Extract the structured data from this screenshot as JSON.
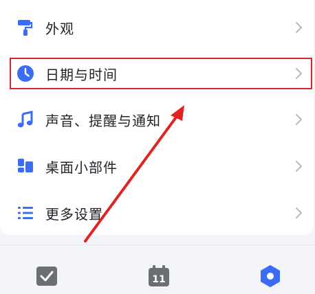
{
  "menu": {
    "items": [
      {
        "label": "外观",
        "icon": "paint-roller-icon"
      },
      {
        "label": "日期与时间",
        "icon": "clock-icon"
      },
      {
        "label": "声音、提醒与通知",
        "icon": "music-note-icon"
      },
      {
        "label": "桌面小部件",
        "icon": "widgets-icon"
      },
      {
        "label": "更多设置",
        "icon": "list-icon"
      }
    ]
  },
  "tabbar": {
    "tabs": [
      {
        "name": "tasks",
        "icon": "checkbox-icon"
      },
      {
        "name": "calendar",
        "icon": "calendar-icon",
        "text": "11"
      },
      {
        "name": "settings",
        "icon": "settings-hex-icon"
      }
    ]
  },
  "colors": {
    "accent": "#3b6cf6",
    "tab_inactive": "#6b6e75",
    "annotation_red": "#e02424",
    "text": "#1f2329",
    "chevron": "#b7b9bf"
  }
}
